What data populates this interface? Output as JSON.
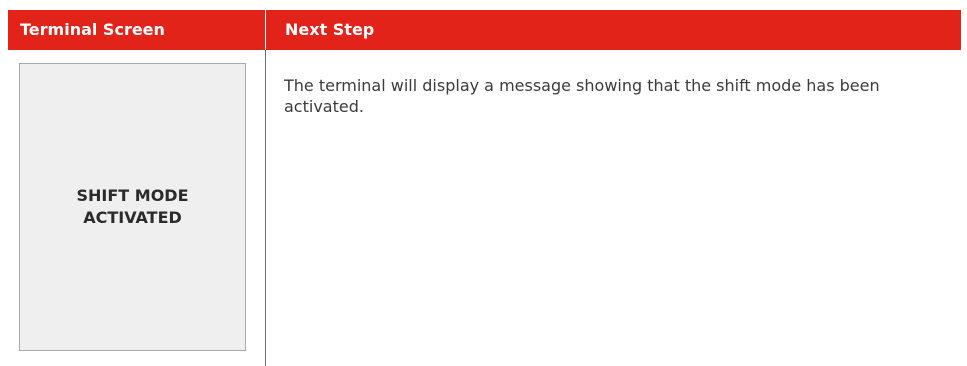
{
  "table": {
    "headers": {
      "terminal_screen": "Terminal Screen",
      "next_step": "Next Step"
    },
    "row": {
      "terminal_display_text": "SHIFT MODE ACTIVATED",
      "next_step_text": "The terminal will display a message showing that the shift mode has been activated."
    }
  },
  "colors": {
    "header_background": "#e1231a",
    "header_text": "#ffffff",
    "screen_background": "#efefef",
    "body_text": "#3b3b3b"
  }
}
